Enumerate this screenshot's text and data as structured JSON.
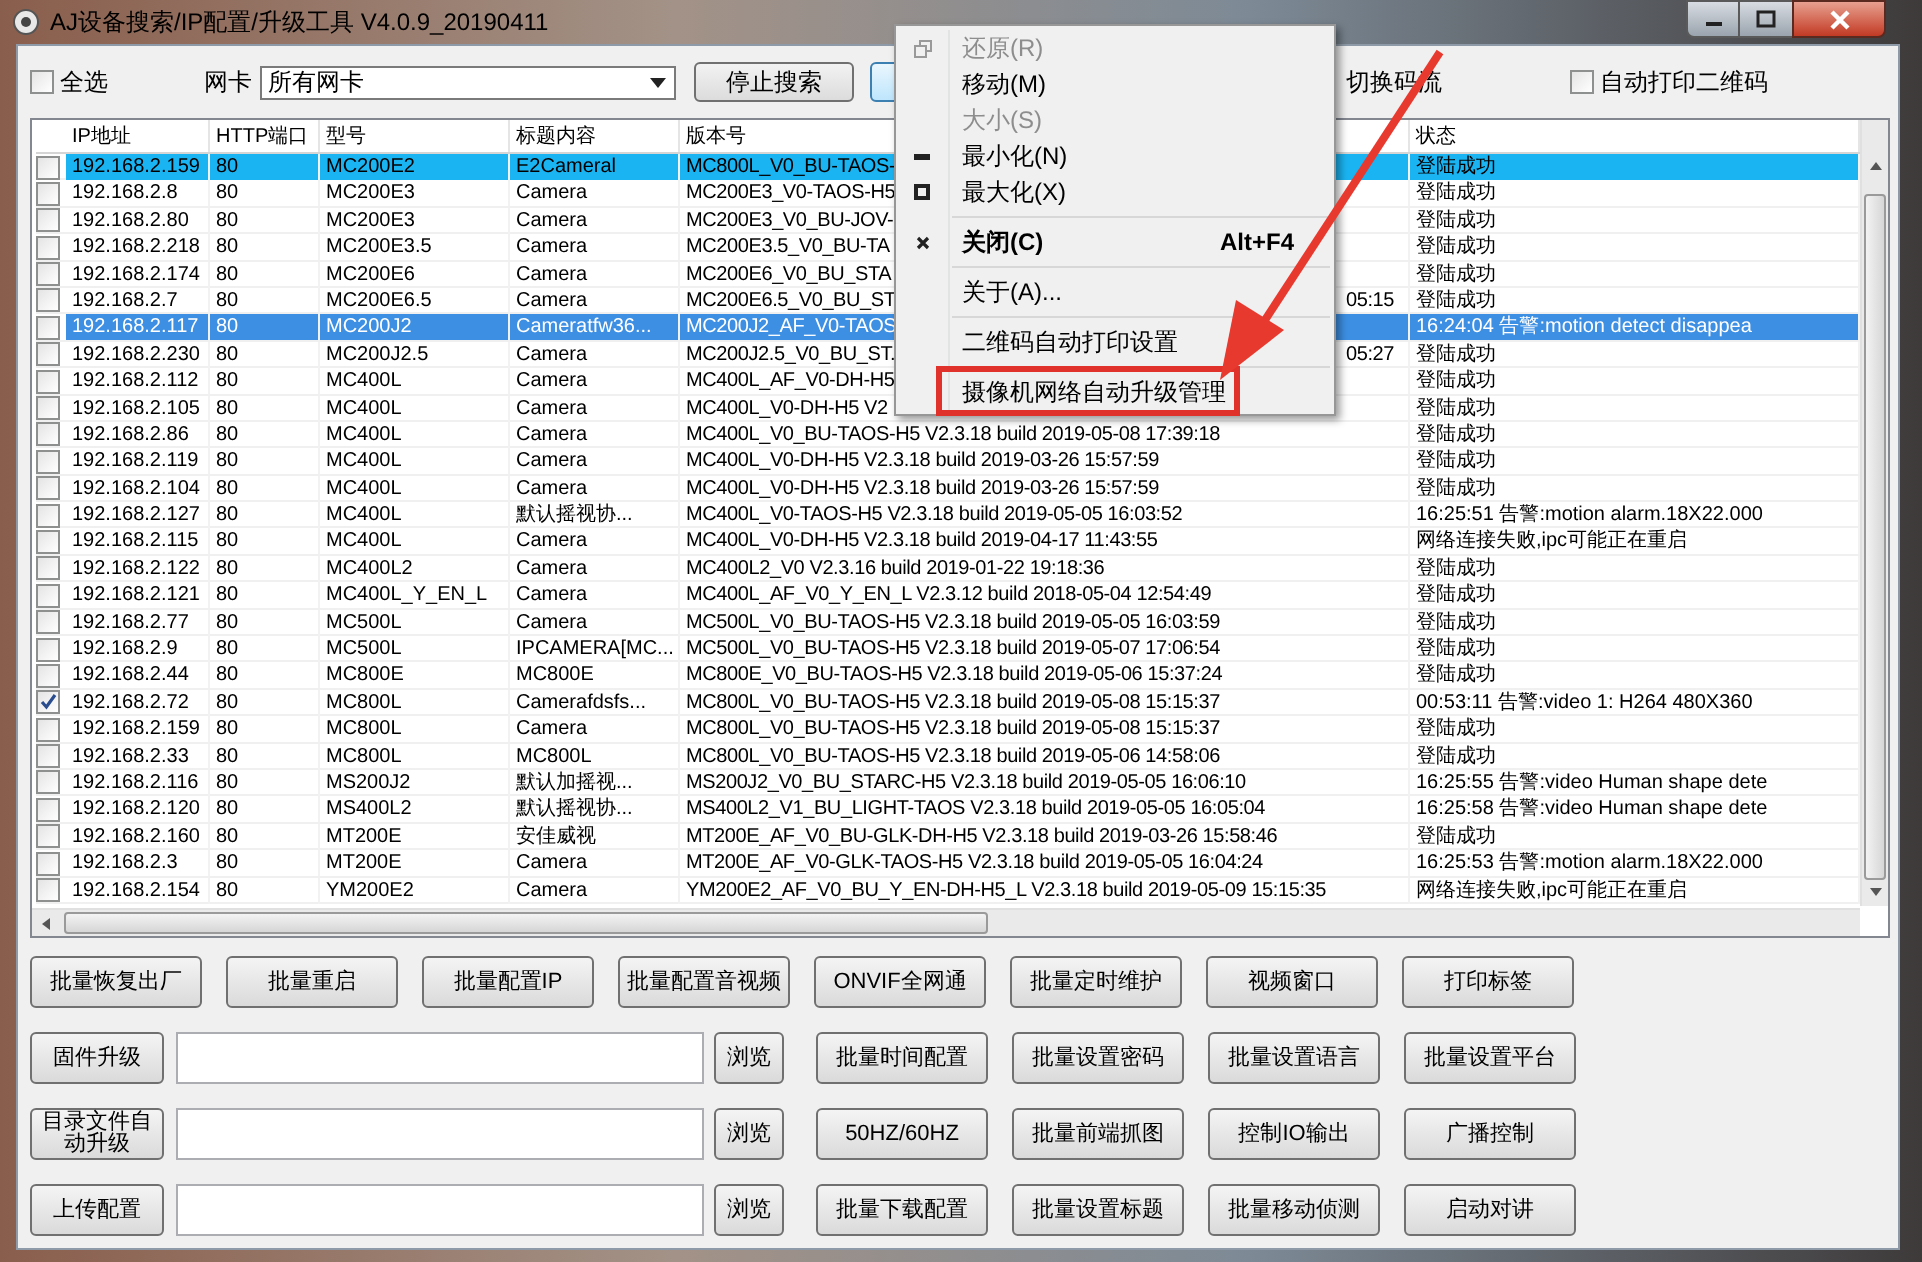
{
  "window": {
    "title": "AJ设备搜索/IP配置/升级工具 V4.0.9_20190411"
  },
  "toolbar": {
    "select_all": {
      "label": "全选",
      "checked": false
    },
    "nic_label": "网卡",
    "nic_select": "所有网卡",
    "stop_button": "停止搜索",
    "stream_switch": "切换码流",
    "auto_print": {
      "label": "自动打印二维码",
      "checked": false
    }
  },
  "table": {
    "columns": [
      "IP地址",
      "HTTP端口",
      "型号",
      "标题内容",
      "版本号",
      "状态"
    ],
    "rows": [
      {
        "checked": false,
        "selected": true,
        "focused": false,
        "ip": "192.168.2.159",
        "port": "80",
        "model": "MC200E2",
        "title": "E2Cameral",
        "version": "MC800L_V0_BU-TAOS-",
        "status": "登陆成功"
      },
      {
        "checked": false,
        "selected": false,
        "ip": "192.168.2.8",
        "port": "80",
        "model": "MC200E3",
        "title": "Camera",
        "version": "MC200E3_V0-TAOS-H5",
        "status": "登陆成功"
      },
      {
        "checked": false,
        "selected": false,
        "ip": "192.168.2.80",
        "port": "80",
        "model": "MC200E3",
        "title": "Camera",
        "version": "MC200E3_V0_BU-JOV-",
        "status": "登陆成功"
      },
      {
        "checked": false,
        "selected": false,
        "ip": "192.168.2.218",
        "port": "80",
        "model": "MC200E3.5",
        "title": "Camera",
        "version": "MC200E3.5_V0_BU-TA",
        "status": "登陆成功"
      },
      {
        "checked": false,
        "selected": false,
        "ip": "192.168.2.174",
        "port": "80",
        "model": "MC200E6",
        "title": "Camera",
        "version": "MC200E6_V0_BU_STA",
        "status": "登陆成功"
      },
      {
        "checked": false,
        "selected": false,
        "ip": "192.168.2.7",
        "port": "80",
        "model": "MC200E6.5",
        "title": "Camera",
        "version": "MC200E6.5_V0_BU_ST.",
        "version_tail": "05:15",
        "status": "登陆成功"
      },
      {
        "checked": false,
        "selected": true,
        "focused": true,
        "ip": "192.168.2.117",
        "port": "80",
        "model": "MC200J2",
        "title": "Cameratfw36...",
        "version": "MC200J2_AF_V0-TAOS",
        "status": "16:24:04 告警:motion detect disappea"
      },
      {
        "checked": false,
        "selected": false,
        "ip": "192.168.2.230",
        "port": "80",
        "model": "MC200J2.5",
        "title": "Camera",
        "version": "MC200J2.5_V0_BU_ST.",
        "version_tail": "05:27",
        "status": "登陆成功"
      },
      {
        "checked": false,
        "selected": false,
        "ip": "192.168.2.112",
        "port": "80",
        "model": "MC400L",
        "title": "Camera",
        "version": "MC400L_AF_V0-DH-H5",
        "status": "登陆成功"
      },
      {
        "checked": false,
        "selected": false,
        "ip": "192.168.2.105",
        "port": "80",
        "model": "MC400L",
        "title": "Camera",
        "version": "MC400L_V0-DH-H5 V2",
        "status": "登陆成功"
      },
      {
        "checked": false,
        "selected": false,
        "ip": "192.168.2.86",
        "port": "80",
        "model": "MC400L",
        "title": "Camera",
        "version": "MC400L_V0_BU-TAOS-H5 V2.3.18 build 2019-05-08 17:39:18",
        "status": "登陆成功"
      },
      {
        "checked": false,
        "selected": false,
        "ip": "192.168.2.119",
        "port": "80",
        "model": "MC400L",
        "title": "Camera",
        "version": "MC400L_V0-DH-H5 V2.3.18 build 2019-03-26 15:57:59",
        "status": "登陆成功"
      },
      {
        "checked": false,
        "selected": false,
        "ip": "192.168.2.104",
        "port": "80",
        "model": "MC400L",
        "title": "Camera",
        "version": "MC400L_V0-DH-H5 V2.3.18 build 2019-03-26 15:57:59",
        "status": "登陆成功"
      },
      {
        "checked": false,
        "selected": false,
        "ip": "192.168.2.127",
        "port": "80",
        "model": "MC400L",
        "title": "默认摇视协...",
        "version": "MC400L_V0-TAOS-H5 V2.3.18 build 2019-05-05 16:03:52",
        "status": "16:25:51 告警:motion alarm.18X22.000"
      },
      {
        "checked": false,
        "selected": false,
        "ip": "192.168.2.115",
        "port": "80",
        "model": "MC400L",
        "title": "Camera",
        "version": "MC400L_V0-DH-H5 V2.3.18 build 2019-04-17 11:43:55",
        "status": "网络连接失败,ipc可能正在重启"
      },
      {
        "checked": false,
        "selected": false,
        "ip": "192.168.2.122",
        "port": "80",
        "model": "MC400L2",
        "title": "Camera",
        "version": "MC400L2_V0 V2.3.16 build 2019-01-22 19:18:36",
        "status": "登陆成功"
      },
      {
        "checked": false,
        "selected": false,
        "ip": "192.168.2.121",
        "port": "80",
        "model": "MC400L_Y_EN_L",
        "title": "Camera",
        "version": "MC400L_AF_V0_Y_EN_L V2.3.12 build 2018-05-04 12:54:49",
        "status": "登陆成功"
      },
      {
        "checked": false,
        "selected": false,
        "ip": "192.168.2.77",
        "port": "80",
        "model": "MC500L",
        "title": "Camera",
        "version": "MC500L_V0_BU-TAOS-H5 V2.3.18 build 2019-05-05 16:03:59",
        "status": "登陆成功"
      },
      {
        "checked": false,
        "selected": false,
        "ip": "192.168.2.9",
        "port": "80",
        "model": "MC500L",
        "title": "IPCAMERA[MC...",
        "version": "MC500L_V0_BU-TAOS-H5 V2.3.18 build 2019-05-07 17:06:54",
        "status": "登陆成功"
      },
      {
        "checked": false,
        "selected": false,
        "ip": "192.168.2.44",
        "port": "80",
        "model": "MC800E",
        "title": "MC800E",
        "version": "MC800E_V0_BU-TAOS-H5 V2.3.18 build 2019-05-06 15:37:24",
        "status": "登陆成功"
      },
      {
        "checked": true,
        "selected": false,
        "ip": "192.168.2.72",
        "port": "80",
        "model": "MC800L",
        "title": "Camerafdsfs...",
        "version": "MC800L_V0_BU-TAOS-H5 V2.3.18 build 2019-05-08 15:15:37",
        "status": "00:53:11 告警:video 1: H264 480X360"
      },
      {
        "checked": false,
        "selected": false,
        "ip": "192.168.2.159",
        "port": "80",
        "model": "MC800L",
        "title": "Camera",
        "version": "MC800L_V0_BU-TAOS-H5 V2.3.18 build 2019-05-08 15:15:37",
        "status": "登陆成功"
      },
      {
        "checked": false,
        "selected": false,
        "ip": "192.168.2.33",
        "port": "80",
        "model": "MC800L",
        "title": "MC800L",
        "version": "MC800L_V0_BU-TAOS-H5 V2.3.18 build 2019-05-06 14:58:06",
        "status": "登陆成功"
      },
      {
        "checked": false,
        "selected": false,
        "ip": "192.168.2.116",
        "port": "80",
        "model": "MS200J2",
        "title": "默认加摇视...",
        "version": "MS200J2_V0_BU_STARC-H5 V2.3.18 build 2019-05-05 16:06:10",
        "status": "16:25:55 告警:video Human shape dete"
      },
      {
        "checked": false,
        "selected": false,
        "ip": "192.168.2.120",
        "port": "80",
        "model": "MS400L2",
        "title": "默认摇视协...",
        "version": "MS400L2_V1_BU_LIGHT-TAOS V2.3.18 build 2019-05-05 16:05:04",
        "status": "16:25:58 告警:video Human shape dete"
      },
      {
        "checked": false,
        "selected": false,
        "ip": "192.168.2.160",
        "port": "80",
        "model": "MT200E",
        "title": "安佳威视",
        "version": "MT200E_AF_V0_BU-GLK-DH-H5 V2.3.18 build 2019-03-26 15:58:46",
        "status": "登陆成功"
      },
      {
        "checked": false,
        "selected": false,
        "ip": "192.168.2.3",
        "port": "80",
        "model": "MT200E",
        "title": "Camera",
        "version": "MT200E_AF_V0-GLK-TAOS-H5 V2.3.18 build 2019-05-05 16:04:24",
        "status": "16:25:53 告警:motion alarm.18X22.000"
      },
      {
        "checked": false,
        "selected": false,
        "ip": "192.168.2.154",
        "port": "80",
        "model": "YM200E2",
        "title": "Camera",
        "version": "YM200E2_AF_V0_BU_Y_EN-DH-H5_L V2.3.18 build 2019-05-09 15:15:35",
        "status": "网络连接失败,ipc可能正在重启"
      }
    ]
  },
  "action_row": [
    "批量恢复出厂",
    "批量重启",
    "批量配置IP",
    "批量配置音视频",
    "ONVIF全网通",
    "批量定时维护",
    "视频窗口",
    "打印标签"
  ],
  "file_rows": [
    {
      "label": "固件升级",
      "browse": "浏览",
      "actions": [
        "批量时间配置",
        "批量设置密码",
        "批量设置语言",
        "批量设置平台"
      ]
    },
    {
      "label": "目录文件自动升级",
      "browse": "浏览",
      "actions": [
        "50HZ/60HZ",
        "批量前端抓图",
        "控制IO输出",
        "广播控制"
      ]
    },
    {
      "label": "上传配置",
      "browse": "浏览",
      "actions": [
        "批量下载配置",
        "批量设置标题",
        "批量移动侦测",
        "启动对讲"
      ]
    }
  ],
  "system_menu": {
    "items": [
      {
        "kind": "restore",
        "label": "还原(R)",
        "disabled": true
      },
      {
        "kind": "plain",
        "label": "移动(M)",
        "disabled": false
      },
      {
        "kind": "plain",
        "label": "大小(S)",
        "disabled": true
      },
      {
        "kind": "minimize",
        "label": "最小化(N)",
        "disabled": false
      },
      {
        "kind": "maximize",
        "label": "最大化(X)",
        "disabled": false
      },
      {
        "kind": "close",
        "label": "关闭(C)",
        "disabled": false,
        "shortcut": "Alt+F4",
        "separator_before": true
      },
      {
        "kind": "plain",
        "label": "关于(A)...",
        "disabled": false,
        "separator_before": true
      },
      {
        "kind": "plain",
        "label": "二维码自动打印设置",
        "disabled": false,
        "separator_before": true
      },
      {
        "kind": "plain",
        "label": "摄像机网络自动升级管理",
        "disabled": false,
        "separator_before": true,
        "annotated": true
      }
    ]
  }
}
